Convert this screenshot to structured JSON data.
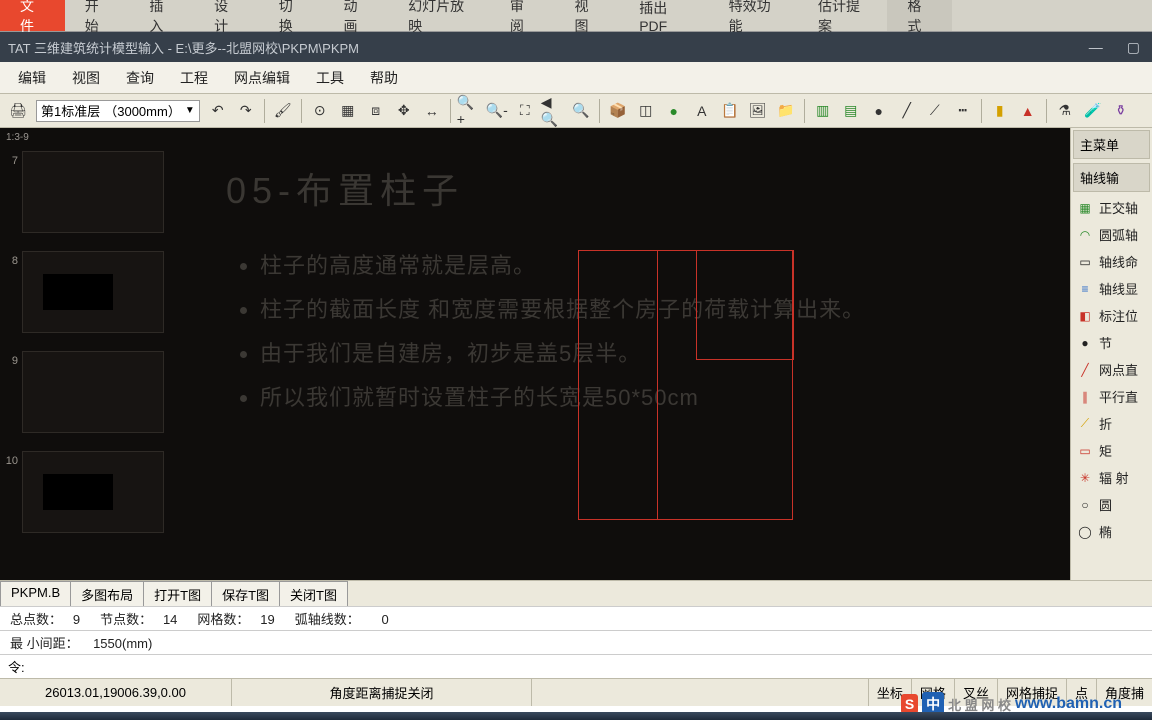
{
  "ribbon": {
    "tabs": [
      "文件",
      "开始",
      "插入",
      "设计",
      "切换",
      "动画",
      "幻灯片放映",
      "审阅",
      "视图",
      "插出PDF",
      "特效功能",
      "估计提案"
    ],
    "format_tab": "格式"
  },
  "titlebar": {
    "text": "TAT 三维建筑统计模型输入 - E:\\更多--北盟网校\\PKPM\\PKPM"
  },
  "menubar": [
    "编辑",
    "视图",
    "查询",
    "工程",
    "网点编辑",
    "工具",
    "帮助"
  ],
  "toolbar": {
    "layer_label": "第1标准层",
    "layer_value": "（3000mm）"
  },
  "slides": {
    "header": "1:3-9",
    "items": [
      {
        "num": "7",
        "dark": false
      },
      {
        "num": "8",
        "dark": true
      },
      {
        "num": "9",
        "dark": false
      },
      {
        "num": "10",
        "dark": true
      }
    ]
  },
  "canvas": {
    "title": "05-布置柱子",
    "bullets": [
      "柱子的高度通常就是层高。",
      "柱子的截面长度 和宽度需要根据整个房子的荷载计算出来。",
      "由于我们是自建房，初步是盖5层半。",
      "所以我们就暂时设置柱子的长宽是50*50cm"
    ]
  },
  "side": {
    "title1": "主菜单",
    "title2": "轴线输",
    "items": [
      "正交轴",
      "圆弧轴",
      "轴线命",
      "轴线显",
      "标注位",
      "节",
      "网点直",
      "平行直",
      "折",
      "矩",
      "辐  射",
      "圆",
      "椭"
    ]
  },
  "bottom_tabs": [
    "PKPM.B",
    "多图布局",
    "打开T图",
    "保存T图",
    "关闭T图"
  ],
  "status": {
    "line1_a": "总点数：",
    "line1_av": "9",
    "line1_b": "节点数：",
    "line1_bv": "14",
    "line1_c": "网格数：",
    "line1_cv": "19",
    "line1_d": "弧轴线数：",
    "line1_dv": "0",
    "line2_a": "最 小间距：",
    "line2_av": "1550(mm)",
    "cmd_prefix": "令:"
  },
  "footer": {
    "coord": "26013.01,19006.39,0.00",
    "mode": "角度距离捕捉关闭",
    "buttons": [
      "坐标",
      "网格",
      "叉丝",
      "网格捕捉",
      "点",
      "角度捕"
    ]
  },
  "logo": {
    "text1": "北 盟 网 校",
    "text2": "www.bamn.cn",
    "ime": "S",
    "cn": "中"
  }
}
